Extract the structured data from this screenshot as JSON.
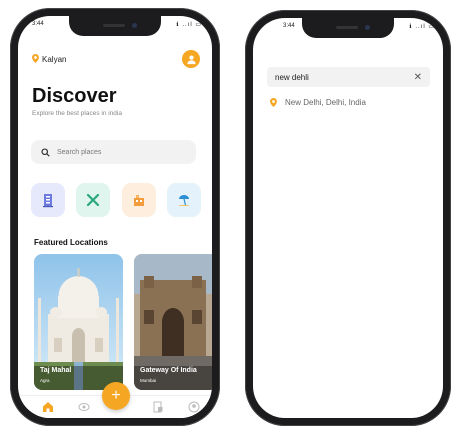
{
  "phone1": {
    "status_time": "3:44",
    "status_icons": "ℹ ..ıl ▭",
    "location": "Kalyan",
    "title": "Discover",
    "subtitle": "Explore the best places in india",
    "search_placeholder": "Search places",
    "categories": [
      {
        "icon": "building-icon",
        "color": "#e6e8fb"
      },
      {
        "icon": "tools-icon",
        "color": "#dff5ee"
      },
      {
        "icon": "hotel-icon",
        "color": "#fdeede"
      },
      {
        "icon": "beach-icon",
        "color": "#e4f2fb"
      }
    ],
    "featured_heading": "Featured Locations",
    "cards": [
      {
        "name": "Taj Mahal",
        "city": "Agra"
      },
      {
        "name": "Gateway Of India",
        "city": "Mumbai"
      }
    ],
    "fab_label": "+",
    "accent": "#f5a623"
  },
  "phone2": {
    "status_time": "3:44",
    "status_icons": "ℹ ..ıl ▭",
    "search_value": "new dehli",
    "close_label": "✕",
    "result": "New Delhi, Delhi, India"
  }
}
